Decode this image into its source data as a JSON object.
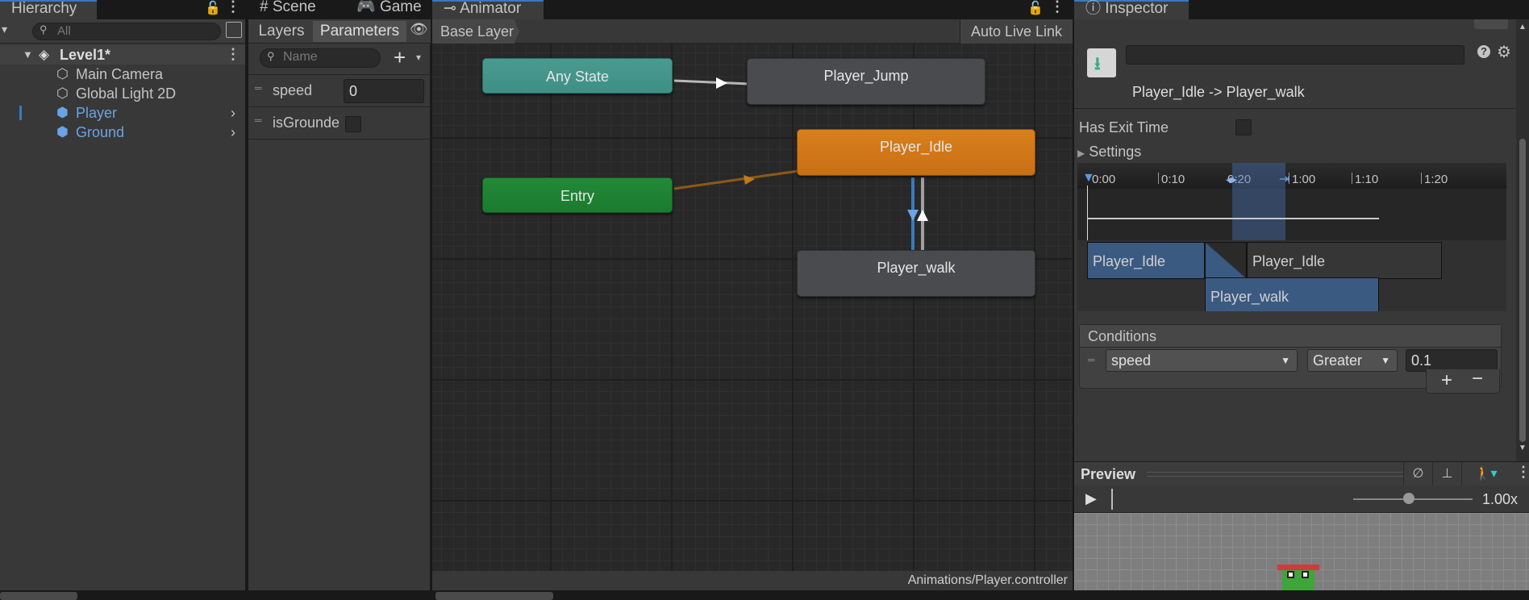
{
  "tabs": {
    "hierarchy": "Hierarchy",
    "scene": "Scene",
    "game": "Game",
    "animator": "Animator",
    "inspector": "Inspector"
  },
  "hierarchy": {
    "search_placeholder": "All",
    "scene_name": "Level1*",
    "items": [
      {
        "label": "Main Camera"
      },
      {
        "label": "Global Light 2D"
      },
      {
        "label": "Player"
      },
      {
        "label": "Ground"
      }
    ]
  },
  "animator": {
    "subtabs": {
      "layers": "Layers",
      "parameters": "Parameters"
    },
    "param_search_placeholder": "Name",
    "params": [
      {
        "name": "speed",
        "value": "0",
        "type": "float"
      },
      {
        "name": "isGrounde",
        "type": "bool",
        "checked": false
      }
    ],
    "breadcrumb": "Base Layer",
    "auto_live_link": "Auto Live Link",
    "states": {
      "any_state": "Any State",
      "entry": "Entry",
      "player_jump": "Player_Jump",
      "player_idle": "Player_Idle",
      "player_walk": "Player_walk"
    },
    "status_path": "Animations/Player.controller"
  },
  "inspector": {
    "transition_title": "Player_Idle -> Player_walk",
    "has_exit_time_label": "Has Exit Time",
    "has_exit_time": false,
    "settings_label": "Settings",
    "timeline_ticks": [
      "0:00",
      "0:10",
      "0:20",
      "1:00",
      "1:10",
      "1:20"
    ],
    "tracks": {
      "idle_a": "Player_Idle",
      "idle_b": "Player_Idle",
      "walk": "Player_walk"
    },
    "conditions_label": "Conditions",
    "condition": {
      "param": "speed",
      "mode": "Greater",
      "threshold": "0.1"
    },
    "preview_label": "Preview",
    "preview_speed": "1.00x"
  },
  "colors": {
    "any_state": "#3e8f86",
    "entry": "#1b7a2f",
    "idle": "#d07718",
    "state": "#4a4b4e",
    "selection_blue": "#3a79bb",
    "link_blue": "#6aa3e6"
  }
}
